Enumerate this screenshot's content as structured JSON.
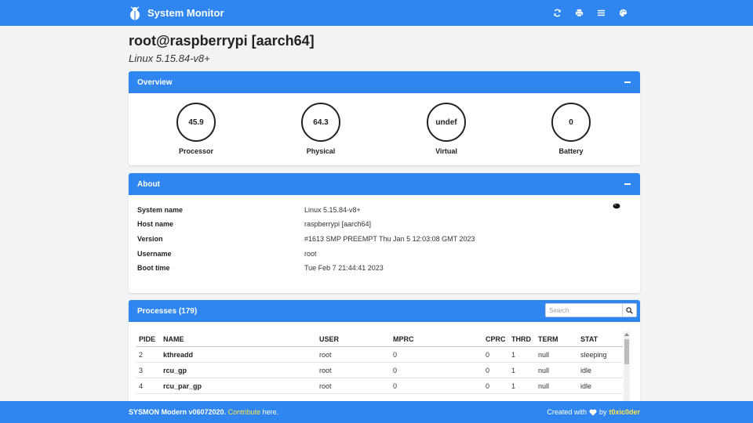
{
  "app": {
    "title": "System Monitor",
    "logo_icon": "bug-icon",
    "accent_color": "#2f86f0",
    "link_color": "#ffe34d"
  },
  "toolbar": {
    "icons": [
      "refresh-icon",
      "print-icon",
      "menu-icon",
      "palette-icon"
    ]
  },
  "host": {
    "title": "root@raspberrypi [aarch64]",
    "subtitle": "Linux 5.15.84-v8+"
  },
  "overview": {
    "header": "Overview",
    "gauges": [
      {
        "value": "45.9",
        "label": "Processor"
      },
      {
        "value": "64.3",
        "label": "Physical"
      },
      {
        "value": "undef",
        "label": "Virtual"
      },
      {
        "value": "0",
        "label": "Battery"
      }
    ]
  },
  "about": {
    "header": "About",
    "rows": [
      {
        "key": "System name",
        "value": "Linux 5.15.84-v8+"
      },
      {
        "key": "Host name",
        "value": "raspberrypi [aarch64]"
      },
      {
        "key": "Version",
        "value": "#1613 SMP PREEMPT Thu Jan 5 12:03:08 GMT 2023"
      },
      {
        "key": "Username",
        "value": "root"
      },
      {
        "key": "Boot time",
        "value": "Tue Feb 7 21:44:41 2023"
      }
    ]
  },
  "processes": {
    "header": "Processes (179)",
    "search_placeholder": "Search",
    "columns": [
      "PIDE",
      "NAME",
      "USER",
      "MPRC",
      "CPRC",
      "THRD",
      "TERM",
      "STAT"
    ],
    "rows": [
      [
        "2",
        "kthreadd",
        "root",
        "0",
        "0",
        "1",
        "null",
        "sleeping"
      ],
      [
        "3",
        "rcu_gp",
        "root",
        "0",
        "0",
        "1",
        "null",
        "idle"
      ],
      [
        "4",
        "rcu_par_gp",
        "root",
        "0",
        "0",
        "1",
        "null",
        "idle"
      ]
    ]
  },
  "footer": {
    "app_name": "SYSMON Modern v06072020.",
    "contribute_link": "Contribute",
    "contribute_suffix": " here.",
    "created_with": "Created with",
    "by": "by",
    "author": "t0xic0der"
  }
}
